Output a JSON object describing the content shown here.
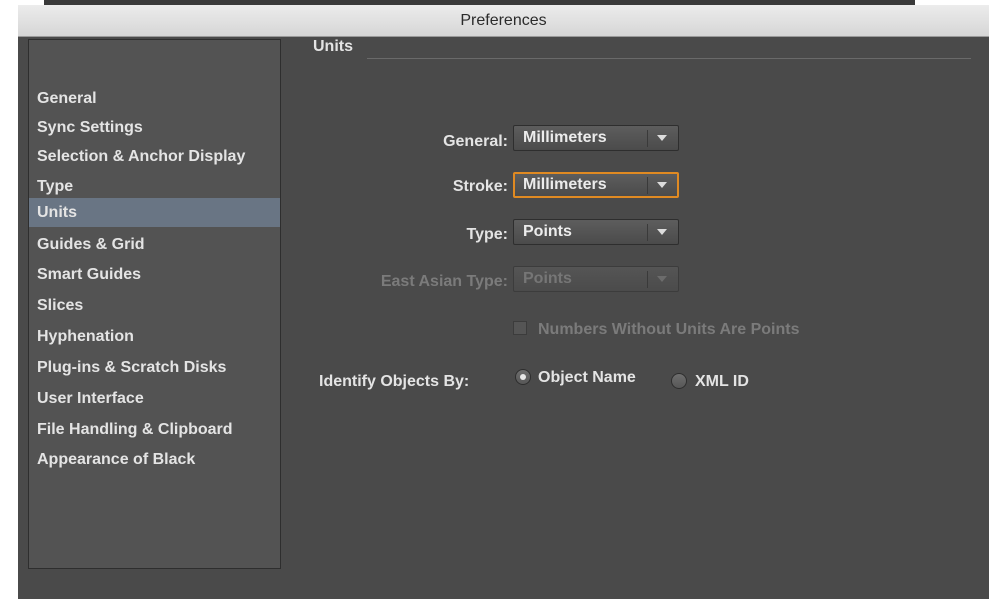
{
  "window": {
    "title": "Preferences"
  },
  "sidebar": {
    "items": [
      {
        "label": "General"
      },
      {
        "label": "Sync Settings"
      },
      {
        "label": "Selection & Anchor Display"
      },
      {
        "label": "Type"
      },
      {
        "label": "Units",
        "selected": true
      },
      {
        "label": "Guides & Grid"
      },
      {
        "label": "Smart Guides"
      },
      {
        "label": "Slices"
      },
      {
        "label": "Hyphenation"
      },
      {
        "label": "Plug-ins & Scratch Disks"
      },
      {
        "label": "User Interface"
      },
      {
        "label": "File Handling & Clipboard"
      },
      {
        "label": "Appearance of Black"
      }
    ]
  },
  "units": {
    "section_title": "Units",
    "general": {
      "label": "General:",
      "value": "Millimeters"
    },
    "stroke": {
      "label": "Stroke:",
      "value": "Millimeters"
    },
    "type": {
      "label": "Type:",
      "value": "Points"
    },
    "east_asian_type": {
      "label": "East Asian Type:",
      "value": "Points",
      "disabled": true
    },
    "numbers_checkbox": {
      "label": "Numbers Without Units Are Points",
      "checked": false,
      "disabled": true
    },
    "identify": {
      "label": "Identify Objects By:",
      "option_object_name": "Object Name",
      "option_xml_id": "XML ID",
      "selected": "Object Name"
    }
  },
  "colors": {
    "panel_bg": "#4a4a4a",
    "sidebar_selected": "#697584",
    "focus_accent": "#e08a22"
  }
}
